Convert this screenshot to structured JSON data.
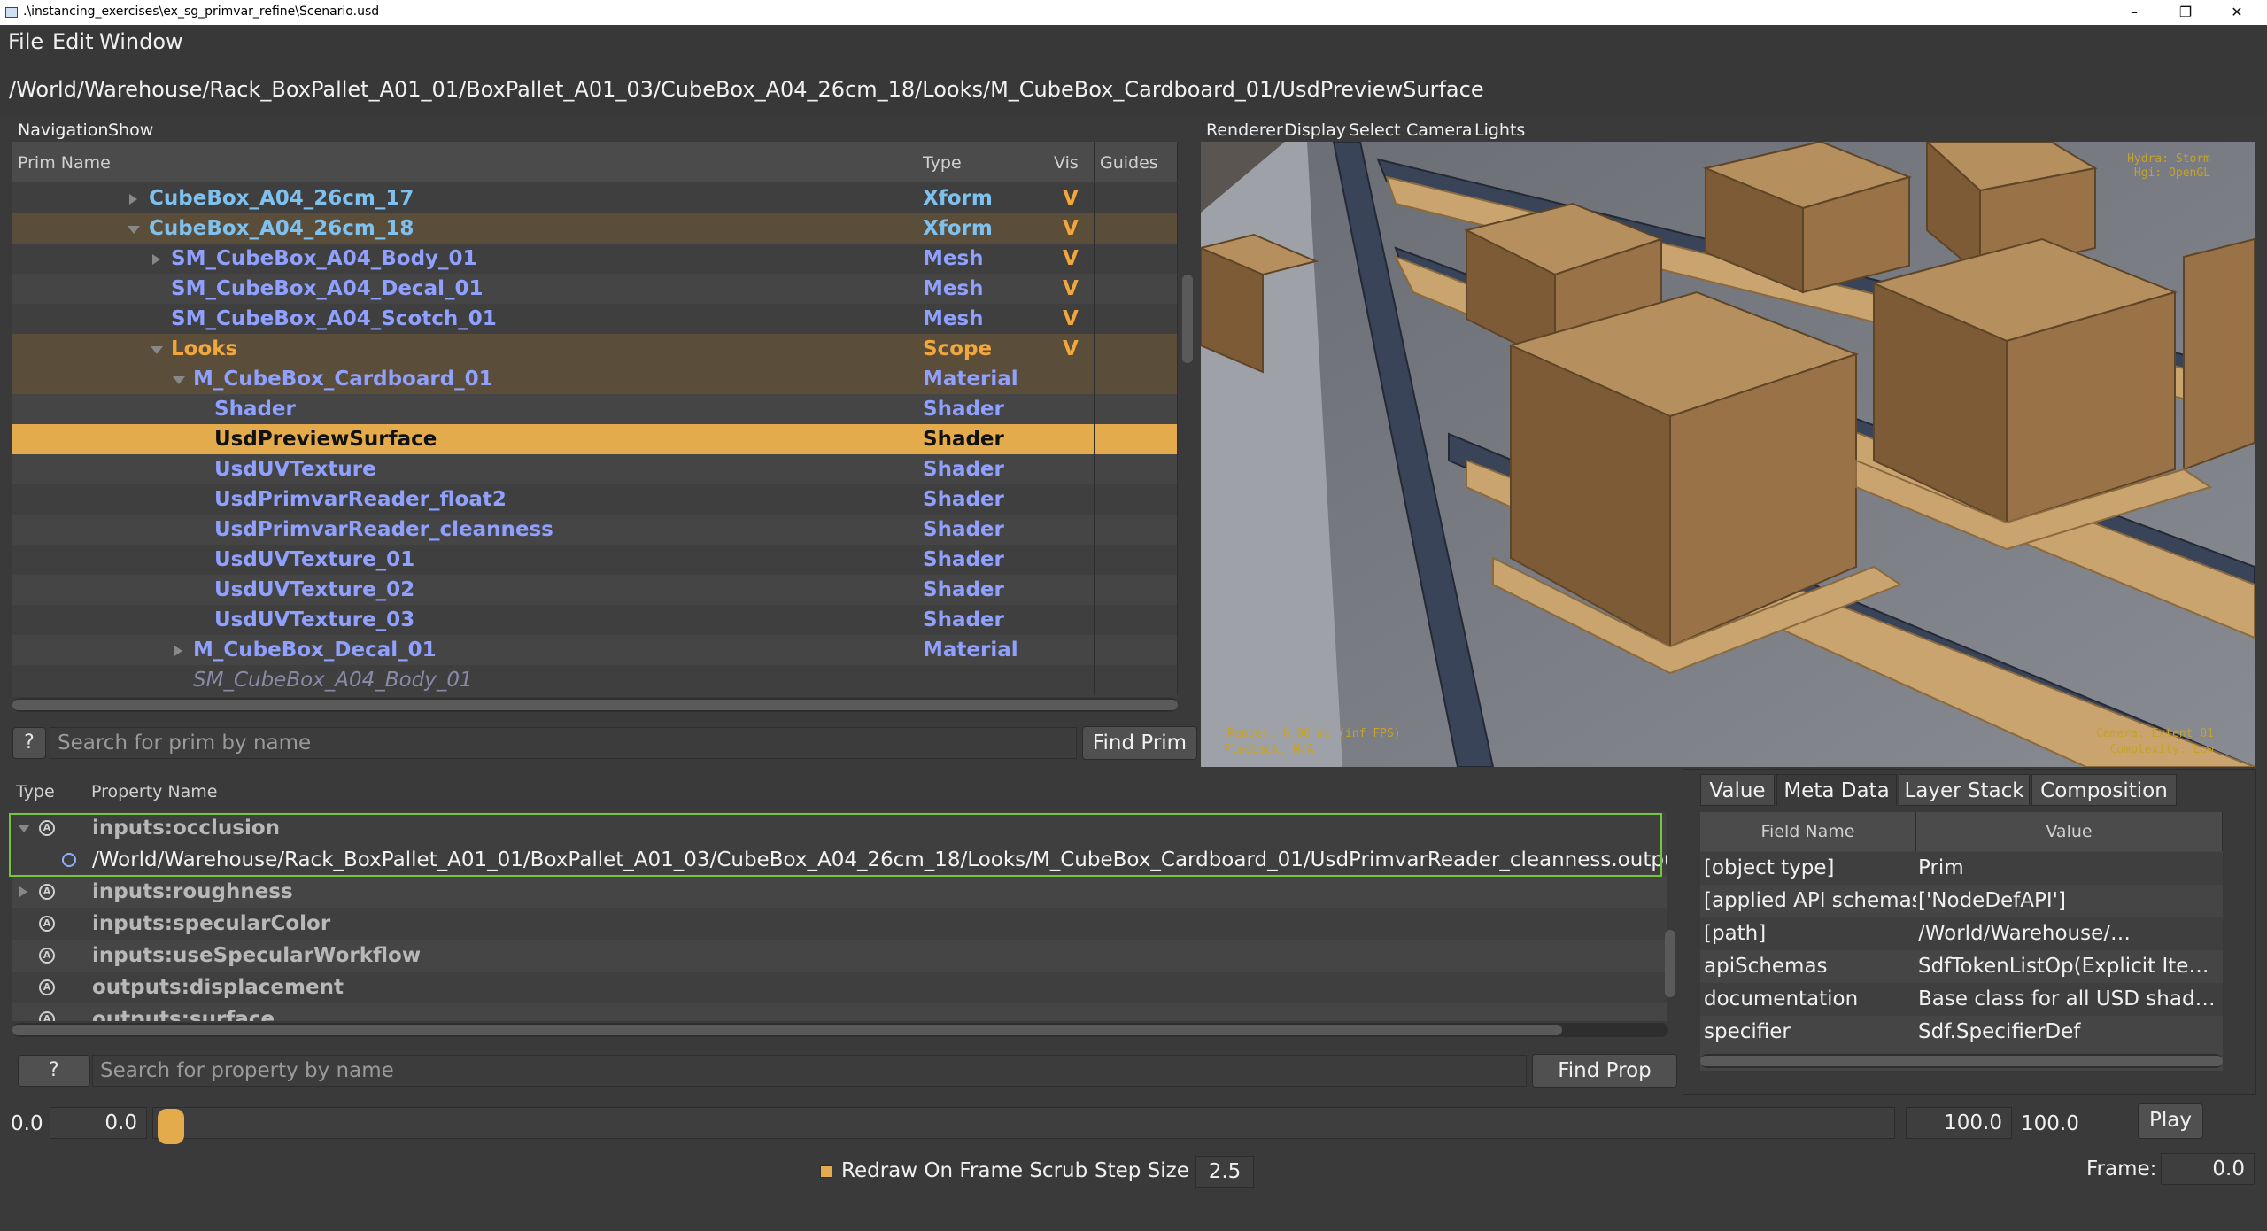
{
  "window": {
    "title": ".\\instancing_exercises\\ex_sg_primvar_refine\\Scenario.usd",
    "minimize": "–",
    "maximize": "❐",
    "close": "✕"
  },
  "menu": [
    "File",
    "Edit",
    "Window"
  ],
  "path": "/World/Warehouse/Rack_BoxPallet_A01_01/BoxPallet_A01_03/CubeBox_A04_26cm_18/Looks/M_CubeBox_Cardboard_01/UsdPreviewSurface",
  "prim_pane": {
    "menus": [
      "Navigation",
      "Show"
    ],
    "columns": [
      "Prim Name",
      "Type",
      "Vis",
      "Guides"
    ],
    "rows": [
      {
        "name": "CubeBox_A04_26cm_17",
        "type": "Xform",
        "vis": "V"
      },
      {
        "name": "CubeBox_A04_26cm_18",
        "type": "Xform",
        "vis": "V"
      },
      {
        "name": "SM_CubeBox_A04_Body_01",
        "type": "Mesh",
        "vis": "V"
      },
      {
        "name": "SM_CubeBox_A04_Decal_01",
        "type": "Mesh",
        "vis": "V"
      },
      {
        "name": "SM_CubeBox_A04_Scotch_01",
        "type": "Mesh",
        "vis": "V"
      },
      {
        "name": "Looks",
        "type": "Scope",
        "vis": "V"
      },
      {
        "name": "M_CubeBox_Cardboard_01",
        "type": "Material",
        "vis": ""
      },
      {
        "name": "Shader",
        "type": "Shader",
        "vis": ""
      },
      {
        "name": "UsdPreviewSurface",
        "type": "Shader",
        "vis": ""
      },
      {
        "name": "UsdUVTexture",
        "type": "Shader",
        "vis": ""
      },
      {
        "name": "UsdPrimvarReader_float2",
        "type": "Shader",
        "vis": ""
      },
      {
        "name": "UsdPrimvarReader_cleanness",
        "type": "Shader",
        "vis": ""
      },
      {
        "name": "UsdUVTexture_01",
        "type": "Shader",
        "vis": ""
      },
      {
        "name": "UsdUVTexture_02",
        "type": "Shader",
        "vis": ""
      },
      {
        "name": "UsdUVTexture_03",
        "type": "Shader",
        "vis": ""
      },
      {
        "name": "M_CubeBox_Decal_01",
        "type": "Material",
        "vis": ""
      },
      {
        "name": "SM_CubeBox_A04_Body_01",
        "type": "",
        "vis": ""
      }
    ],
    "search_help": "?",
    "search_placeholder": "Search for prim by name",
    "find_button": "Find Prim"
  },
  "viewport": {
    "menus": [
      "Renderer",
      "Display",
      "Select",
      "Camera",
      "Lights"
    ],
    "hud_top_right_1": "Hydra: Storm",
    "hud_top_right_2": "Hgi: OpenGL",
    "hud_bottom_left_1": "Render: 0.00 ms (inf FPS)",
    "hud_bottom_left_2": "Playback: N/A",
    "hud_bottom_right_1": "Camera: Extent 01",
    "hud_bottom_right_2": "Complexity: Low"
  },
  "property_pane": {
    "columns": [
      "Type",
      "Property Name"
    ],
    "rows": [
      {
        "name": "inputs:occlusion"
      },
      {
        "name": "/World/Warehouse/Rack_BoxPallet_A01_01/BoxPallet_A01_03/CubeBox_A04_26cm_18/Looks/M_CubeBox_Cardboard_01/UsdPrimvarReader_cleanness.outputs:result"
      },
      {
        "name": "inputs:roughness"
      },
      {
        "name": "inputs:specularColor"
      },
      {
        "name": "inputs:useSpecularWorkflow"
      },
      {
        "name": "outputs:displacement"
      },
      {
        "name": "outputs:surface"
      }
    ],
    "search_help": "?",
    "search_placeholder": "Search for property by name",
    "find_button": "Find Prop"
  },
  "inspector": {
    "tabs": [
      "Value",
      "Meta Data",
      "Layer Stack",
      "Composition"
    ],
    "columns": [
      "Field Name",
      "Value"
    ],
    "rows": [
      {
        "field": "[object type]",
        "value": "Prim"
      },
      {
        "field": "[applied API schemas]",
        "value": "['NodeDefAPI']"
      },
      {
        "field": "[path]",
        "value": "/World/Warehouse/…"
      },
      {
        "field": "apiSchemas",
        "value": "SdfTokenListOp(Explicit Items:…"
      },
      {
        "field": "documentation",
        "value": "Base class for all USD shaders…"
      },
      {
        "field": "specifier",
        "value": "Sdf.SpecifierDef"
      }
    ]
  },
  "timeline": {
    "start_label": "0.0",
    "start_value": "0.0",
    "end_value": "100.0",
    "end_label": "100.0",
    "play_button": "Play",
    "redraw_label": "Redraw On Frame Scrub",
    "step_size_label": "Step Size",
    "step_size_value": "2.5",
    "frame_label": "Frame:",
    "frame_value": "0.0",
    "slider_position": 0.0
  },
  "colors": {
    "selection": "#e4ab4c",
    "prim_xform": "#7ec0ee",
    "prim_other": "#8fa0ff",
    "looks": "#f1a73e",
    "hud": "#c5a22a",
    "connection_box": "#77c53a"
  }
}
